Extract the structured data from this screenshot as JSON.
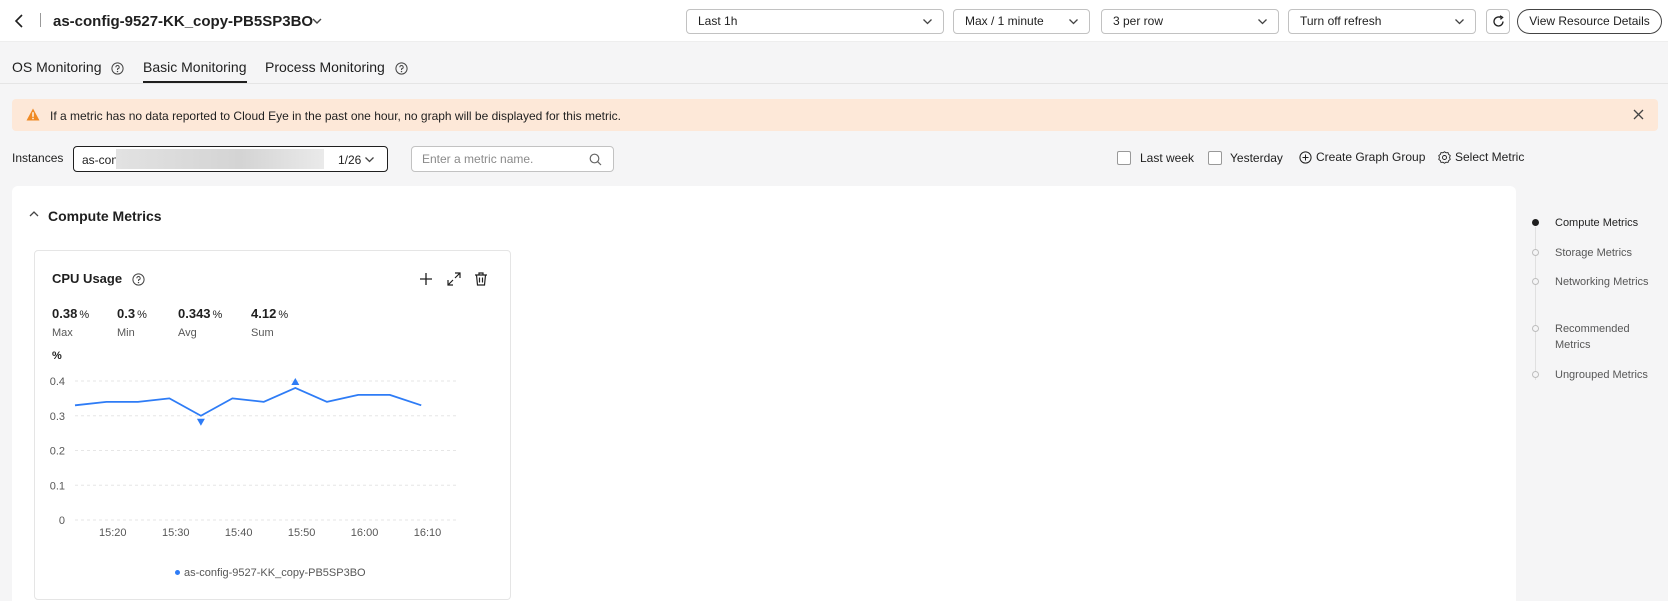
{
  "header": {
    "title": "as-config-9527-KK_copy-PB5SP3BO",
    "time_range": "Last 1h",
    "aggregation": "Max / 1 minute",
    "layout": "3 per row",
    "refresh": "Turn off refresh",
    "view_details": "View Resource Details"
  },
  "tabs": [
    {
      "label": "OS Monitoring",
      "active": false
    },
    {
      "label": "Basic Monitoring",
      "active": true
    },
    {
      "label": "Process Monitoring",
      "active": false
    }
  ],
  "alert": {
    "text": "If a metric has no data reported to Cloud Eye in the past one hour, no graph will be displayed for this metric."
  },
  "filters": {
    "instances_label": "Instances",
    "instance_value": "as-conf",
    "instance_count": "1/26",
    "search_placeholder": "Enter a metric name.",
    "last_week": "Last week",
    "yesterday": "Yesterday",
    "create_group": "Create Graph Group",
    "select_metric": "Select Metric"
  },
  "section": {
    "title": "Compute Metrics"
  },
  "card": {
    "title": "CPU Usage",
    "stats": [
      {
        "value": "0.38",
        "unit": "%",
        "name": "Max"
      },
      {
        "value": "0.3",
        "unit": "%",
        "name": "Min"
      },
      {
        "value": "0.343",
        "unit": "%",
        "name": "Avg"
      },
      {
        "value": "4.12",
        "unit": "%",
        "name": "Sum"
      }
    ],
    "legend": "as-config-9527-KK_copy-PB5SP3BO"
  },
  "chart_data": {
    "type": "line",
    "ylabel": "%",
    "ylim": [
      0,
      0.4
    ],
    "yticks": [
      "0",
      "0.1",
      "0.2",
      "0.3",
      "0.4"
    ],
    "xticks": [
      "15:20",
      "15:30",
      "15:40",
      "15:50",
      "16:00",
      "16:10"
    ],
    "grid": true,
    "series": [
      {
        "name": "as-config-9527-KK_copy-PB5SP3BO",
        "color": "#2e7cf6",
        "x": [
          "15:14",
          "15:19",
          "15:24",
          "15:29",
          "15:34",
          "15:39",
          "15:44",
          "15:49",
          "15:54",
          "15:59",
          "16:04",
          "16:09"
        ],
        "values": [
          0.33,
          0.34,
          0.34,
          0.35,
          0.3,
          0.35,
          0.34,
          0.38,
          0.34,
          0.36,
          0.36,
          0.33
        ],
        "max_index": 7,
        "min_index": 4
      }
    ]
  },
  "anchors": [
    {
      "label": "Compute Metrics",
      "active": true
    },
    {
      "label": "Storage Metrics",
      "active": false
    },
    {
      "label": "Networking Metrics",
      "active": false
    },
    {
      "label": "Recommended Metrics",
      "active": false
    },
    {
      "label": "Ungrouped Metrics",
      "active": false
    }
  ]
}
